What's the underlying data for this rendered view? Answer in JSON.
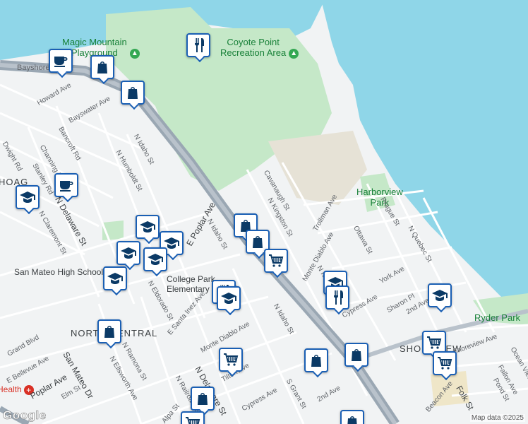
{
  "map": {
    "attribution": "Map data ©2025",
    "logo": "Google",
    "colors": {
      "water": "#8fd6e8",
      "park": "#c5e8c8",
      "road": "#ffffff",
      "highway": "#9aa7b3",
      "land": "#f1f3f4",
      "pin_border": "#1a5fb4",
      "pin_icon": "#0b3a66"
    }
  },
  "pois": [
    {
      "name": "Magic Mountain\nPlayground",
      "icon": "tree-icon"
    },
    {
      "name": "Coyote Point\nRecreation Area",
      "icon": "tree-icon"
    },
    {
      "name": "Harborview\nPark",
      "icon": "none"
    },
    {
      "name": "Ryder Park",
      "icon": "none"
    },
    {
      "name": "College Park\nElementary School",
      "icon": "none"
    },
    {
      "name": "San Mateo High School",
      "icon": "none"
    },
    {
      "name": "Health",
      "icon": "hospital-icon"
    }
  ],
  "districts": [
    {
      "name": "NORTH CENTRAL"
    },
    {
      "name": "HOAG"
    },
    {
      "name": "SHOREVIEW"
    }
  ],
  "streets": [
    "Bayshore Fwy",
    "Howard Ave",
    "Bayswater Ave",
    "Bancroft Rd",
    "Channing Rd",
    "Dwight Rd",
    "Stanley Rd",
    "N Idaho St",
    "N Humboldt St",
    "N Delaware St",
    "N Claremont St",
    "E Poplar Ave",
    "N Idaho St",
    "Cavanaugh St",
    "N Kingston St",
    "Trollman Ave",
    "Ottawa St",
    "Prague St",
    "N Quebec St",
    "York Ave",
    "Monte Diablo Ave",
    "N Kingston St",
    "Cypress Ave",
    "Sharon Pl",
    "2nd Ave",
    "N Eldorado St",
    "E Santa Inez Ave",
    "N Idaho St",
    "Monte Diablo Ave",
    "Tilton Ave",
    "Cypress Ave",
    "S Grant St",
    "2nd Ave",
    "N Ramona St",
    "N Ellsworth Ave",
    "San Mateo Dr",
    "Grand Blvd",
    "E Bellevue Ave",
    "Poplar Ave",
    "Elm St",
    "N Railroad Ave",
    "Alpa St",
    "N Delaware St",
    "Shoreview Ave",
    "Fallon Ave",
    "Ocean View",
    "Pond St",
    "Beacon Ave",
    "Folk St",
    "Bayshore Fwy"
  ],
  "markers": [
    {
      "type": "restaurant",
      "label": "restaurant-marker"
    },
    {
      "type": "cafe",
      "label": "cafe-marker"
    },
    {
      "type": "shopping",
      "label": "shopping-marker"
    },
    {
      "type": "shopping",
      "label": "shopping-marker"
    },
    {
      "type": "cafe",
      "label": "cafe-marker"
    },
    {
      "type": "school",
      "label": "school-marker"
    },
    {
      "type": "school",
      "label": "school-marker"
    },
    {
      "type": "school",
      "label": "school-marker"
    },
    {
      "type": "school",
      "label": "school-marker"
    },
    {
      "type": "school",
      "label": "school-marker"
    },
    {
      "type": "school",
      "label": "school-marker"
    },
    {
      "type": "shopping",
      "label": "shopping-marker"
    },
    {
      "type": "shopping",
      "label": "shopping-marker"
    },
    {
      "type": "grocery",
      "label": "grocery-marker"
    },
    {
      "type": "restaurant",
      "label": "restaurant-marker"
    },
    {
      "type": "school",
      "label": "school-marker"
    },
    {
      "type": "school",
      "label": "school-marker"
    },
    {
      "type": "restaurant",
      "label": "restaurant-marker"
    },
    {
      "type": "school",
      "label": "school-marker"
    },
    {
      "type": "shopping",
      "label": "shopping-marker"
    },
    {
      "type": "grocery",
      "label": "grocery-marker"
    },
    {
      "type": "shopping",
      "label": "shopping-marker"
    },
    {
      "type": "shopping",
      "label": "shopping-marker"
    },
    {
      "type": "grocery",
      "label": "grocery-marker"
    },
    {
      "type": "grocery",
      "label": "grocery-marker"
    },
    {
      "type": "shopping",
      "label": "shopping-marker"
    },
    {
      "type": "grocery",
      "label": "grocery-marker"
    },
    {
      "type": "shopping",
      "label": "shopping-marker"
    }
  ]
}
